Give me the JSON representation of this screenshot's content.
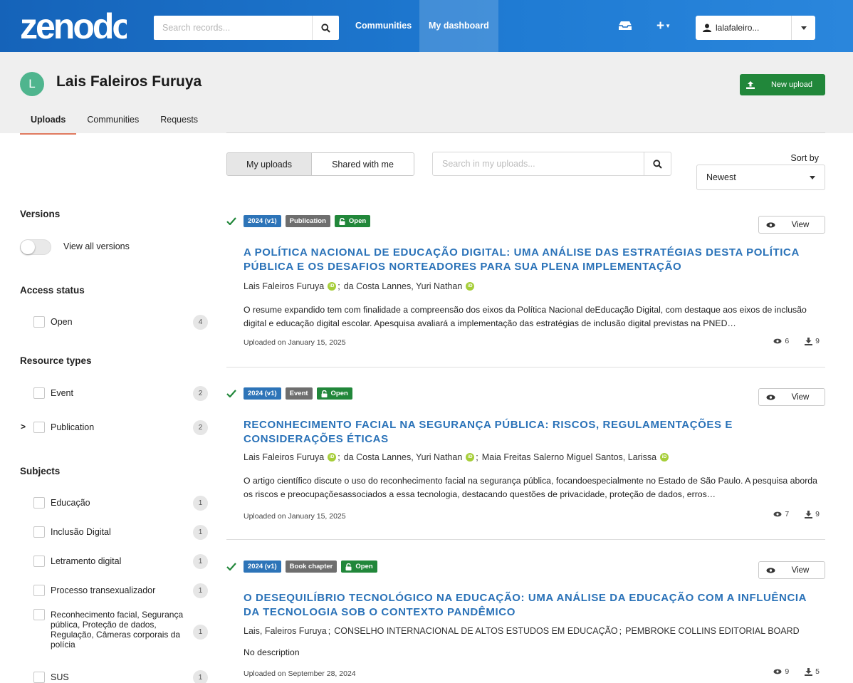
{
  "nav": {
    "logo_text": "zenodo",
    "search_placeholder": "Search records...",
    "links": [
      "Communities",
      "My dashboard"
    ],
    "plus_label": "+",
    "user_label": "lalafaleiro..."
  },
  "profile": {
    "avatar_letter": "L",
    "name": "Lais Faleiros Furuya",
    "new_upload_label": "New upload",
    "tabs": [
      "Uploads",
      "Communities",
      "Requests"
    ]
  },
  "toolbar": {
    "seg_my": "My uploads",
    "seg_shared": "Shared with me",
    "search_placeholder": "Search in my uploads...",
    "sort_label": "Sort by",
    "sort_value": "Newest"
  },
  "sidebar": {
    "versions_heading": "Versions",
    "view_all_versions": "View all versions",
    "access_heading": "Access status",
    "access_items": [
      {
        "label": "Open",
        "count": "4"
      }
    ],
    "resource_heading": "Resource types",
    "resource_items": [
      {
        "label": "Event",
        "count": "2"
      },
      {
        "label": "Publication",
        "count": "2"
      }
    ],
    "subjects_heading": "Subjects",
    "subject_items": [
      {
        "label": "Educação",
        "count": "1"
      },
      {
        "label": "Inclusão Digital",
        "count": "1"
      },
      {
        "label": "Letramento digital",
        "count": "1"
      },
      {
        "label": "Processo transexualizador",
        "count": "1"
      },
      {
        "label": "Reconhecimento facial, Segurança pública, Proteção de dados, Regulação, Câmeras corporais da polícia",
        "count": "1"
      },
      {
        "label": "SUS",
        "count": "1"
      }
    ]
  },
  "results": [
    {
      "version": "2024 (v1)",
      "type": "Publication",
      "access": "Open",
      "view_label": "View",
      "title": "A POLÍTICA NACIONAL DE EDUCAÇÃO DIGITAL: UMA ANÁLISE DAS ESTRATÉGIAS DESTA POLÍTICA PÚBLICA E OS DESAFIOS NORTEADORES PARA SUA PLENA IMPLEMENTAÇÃO",
      "authors": [
        "Lais Faleiros Furuya",
        "da Costa Lannes, Yuri Nathan"
      ],
      "description": "O resume expandido tem com finalidade a compreensão dos eixos da Política Nacional deEducação Digital, com destaque aos eixos de inclusão digital e educação digital escolar. Apesquisa avaliará a implementação das estratégias de inclusão digital previstas na PNED…",
      "date": "Uploaded on January 15, 2025",
      "views": "6",
      "downloads": "9"
    },
    {
      "version": "2024 (v1)",
      "type": "Event",
      "access": "Open",
      "view_label": "View",
      "title": "RECONHECIMENTO FACIAL NA SEGURANÇA PÚBLICA: RISCOS, REGULAMENTAÇÕES E CONSIDERAÇÕES ÉTICAS",
      "authors": [
        "Lais Faleiros Furuya",
        "da Costa Lannes, Yuri Nathan",
        "Maia Freitas Salerno Miguel Santos, Larissa"
      ],
      "description": "O artigo científico discute o uso do reconhecimento facial na segurança pública, focandoespecialmente no Estado de São Paulo. A pesquisa aborda os riscos e preocupaçõesassociados a essa tecnologia, destacando questões de privacidade, proteção de dados, erros…",
      "date": "Uploaded on January 15, 2025",
      "views": "7",
      "downloads": "9"
    },
    {
      "version": "2024 (v1)",
      "type": "Book chapter",
      "access": "Open",
      "view_label": "View",
      "title": "O DESEQUILÍBRIO TECNOLÓGICO NA EDUCAÇÃO: UMA ANÁLISE DA EDUCAÇÃO COM A INFLUÊNCIA DA TECNOLOGIA SOB O CONTEXTO PANDÊMICO",
      "authors": [
        "Lais, Faleiros Furuya",
        "CONSELHO INTERNACIONAL DE ALTOS ESTUDOS EM EDUCAÇÃO",
        "PEMBROKE COLLINS EDITORIAL BOARD"
      ],
      "description": "No description",
      "date": "Uploaded on September 28, 2024",
      "views": "9",
      "downloads": "5"
    }
  ],
  "colors": {
    "nav_blue": "#1a70c8",
    "link_blue": "#2a72b8",
    "green": "#21873a",
    "version_blue": "#2d74b8",
    "type_gray": "#6e6e6e",
    "orcid_green": "#a6ce39"
  },
  "icons": [
    "search-icon",
    "inbox-icon",
    "plus-icon",
    "user-icon",
    "chevron-down-icon",
    "upload-icon",
    "check-icon",
    "lock-icon",
    "eye-icon",
    "download-icon",
    "orcid-icon",
    "chevron-right-icon"
  ]
}
